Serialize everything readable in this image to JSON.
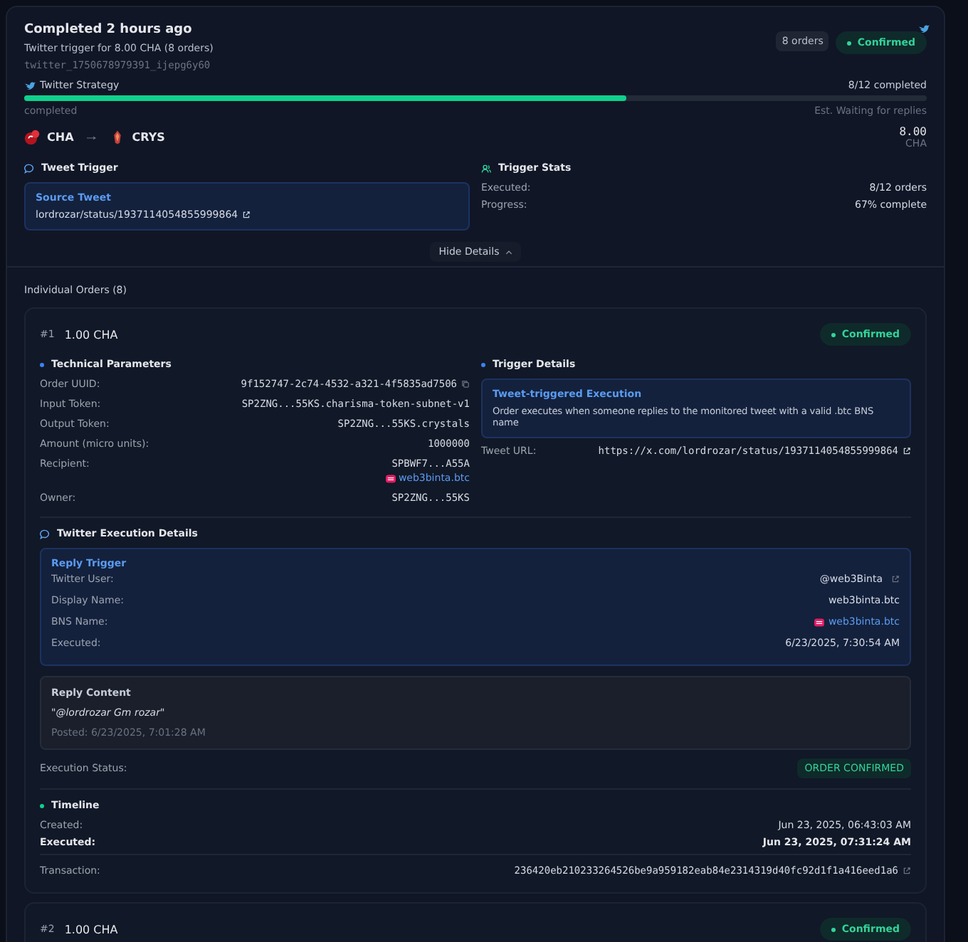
{
  "header": {
    "title": "Completed 2 hours ago",
    "subtitle": "Twitter trigger for 8.00 CHA (8 orders)",
    "trigger_id": "twitter_1750678979391_ijepg6y60",
    "orders_badge": "8 orders",
    "status": {
      "label": "Confirmed",
      "kind": "confirmed"
    }
  },
  "strategy": {
    "name": "Twitter Strategy",
    "progress_text": "8/12 completed",
    "level": 0.667,
    "state_text": "completed",
    "eta": "Est. Waiting for replies"
  },
  "swap": {
    "from": "CHA",
    "to": "CRYS",
    "amount": "8.00",
    "unit": "CHA"
  },
  "tweet_trigger": {
    "heading": "Tweet Trigger",
    "box_title": "Source Tweet",
    "link": "lordrozar/status/1937114054855999864"
  },
  "trigger_stats": {
    "heading": "Trigger Stats",
    "rows": [
      {
        "label": "Executed:",
        "value": "8/12 orders"
      },
      {
        "label": "Progress:",
        "value": "67% complete"
      }
    ]
  },
  "toggle": {
    "label": "Hide Details",
    "expanded": true
  },
  "orders_heading": "Individual Orders (8)",
  "orders": [
    {
      "number": "#1",
      "amount": "1.00 CHA",
      "status": {
        "label": "Confirmed",
        "kind": "confirmed"
      },
      "expanded": true,
      "technical": {
        "heading": "Technical Parameters",
        "rows": [
          {
            "label": "Order UUID:",
            "value": "9f152747-2c74-4532-a321-4f5835ad7506",
            "kind": "copy"
          },
          {
            "label": "Input Token:",
            "value": "SP2ZNG...55KS.charisma-token-subnet-v1",
            "kind": "mono"
          },
          {
            "label": "Output Token:",
            "value": "SP2ZNG...55KS.crystals",
            "kind": "mono"
          },
          {
            "label": "Amount (micro units):",
            "value": "1000000",
            "kind": "mono"
          },
          {
            "label": "Recipient:",
            "value": "SPBWF7...A55A",
            "bns": "web3binta.btc",
            "kind": "recipient"
          },
          {
            "label": "Owner:",
            "value": "SP2ZNG...55KS",
            "kind": "mono"
          }
        ]
      },
      "trigger": {
        "heading": "Trigger Details",
        "box_title": "Tweet-triggered Execution",
        "box_text": "Order executes when someone replies to the monitored tweet with a valid .btc BNS name",
        "url_label": "Tweet URL:",
        "url": "https://x.com/lordrozar/status/1937114054855999864"
      },
      "execution": {
        "heading": "Twitter Execution Details",
        "box_title": "Reply Trigger",
        "rows": [
          {
            "label": "Twitter User:",
            "value": "@web3Binta",
            "kind": "external"
          },
          {
            "label": "Display Name:",
            "value": "web3binta.btc",
            "kind": "plain"
          },
          {
            "label": "BNS Name:",
            "value": "web3binta.btc",
            "kind": "bns"
          },
          {
            "label": "Executed:",
            "value": "6/23/2025, 7:30:54 AM",
            "kind": "plain"
          }
        ],
        "reply_title": "Reply Content",
        "reply_text": "\"@lordrozar Gm rozar\"",
        "reply_posted": "Posted: 6/23/2025, 7:01:28 AM"
      },
      "execution_status_label": "Execution Status:",
      "execution_status": {
        "label": "ORDER CONFIRMED",
        "kind": "confirmed"
      },
      "timeline": {
        "heading": "Timeline",
        "rows": [
          {
            "label": "Created:",
            "value": "Jun 23, 2025, 06:43:03 AM",
            "emphasis": false
          },
          {
            "label": "Executed:",
            "value": "Jun 23, 2025, 07:31:24 AM",
            "emphasis": true
          }
        ],
        "tx_label": "Transaction:",
        "tx": "236420eb210233264526be9a959182eab84e2314319d40fc92d1f1a416eed1a6"
      }
    },
    {
      "number": "#2",
      "amount": "1.00 CHA",
      "status": {
        "label": "Confirmed",
        "kind": "confirmed"
      },
      "expanded": false
    }
  ]
}
